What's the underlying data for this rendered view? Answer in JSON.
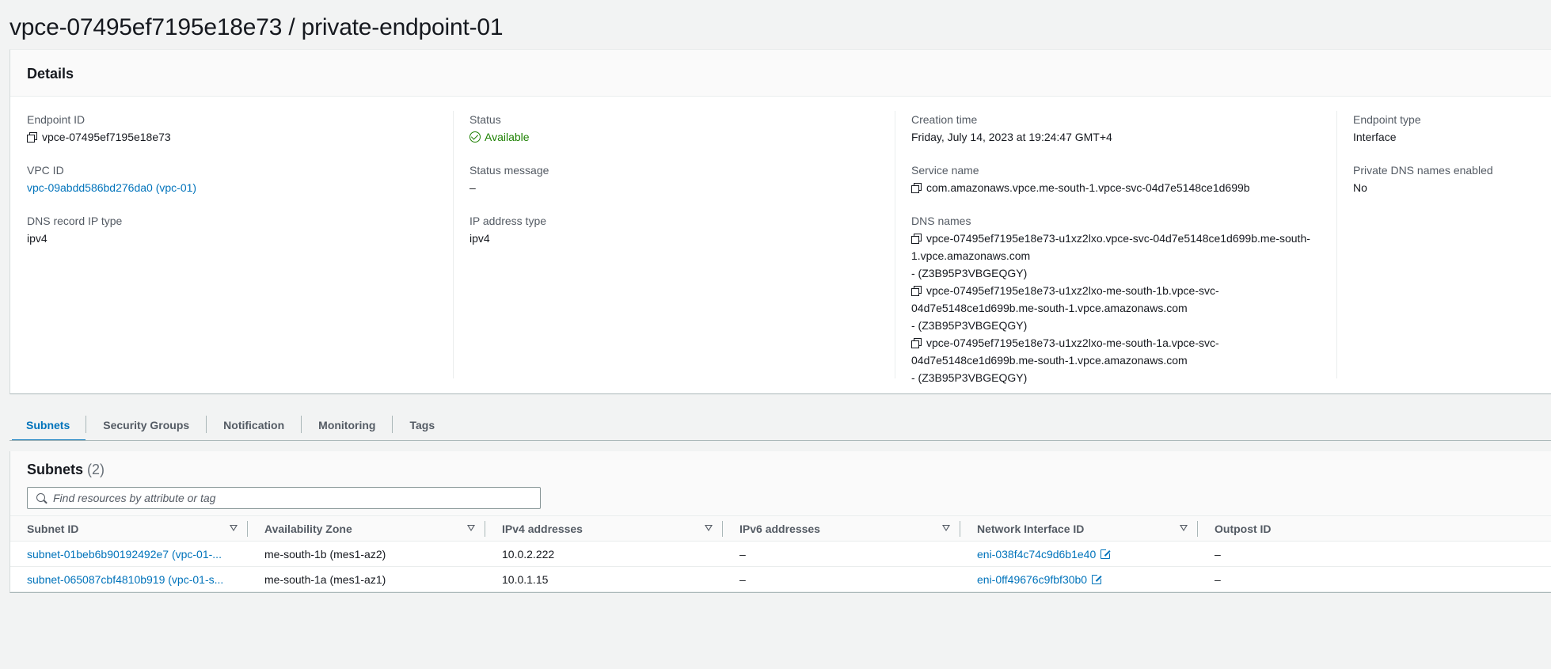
{
  "page": {
    "title": "vpce-07495ef7195e18e73 / private-endpoint-01"
  },
  "details": {
    "heading": "Details",
    "endpoint_id": {
      "label": "Endpoint ID",
      "value": "vpce-07495ef7195e18e73"
    },
    "vpc_id": {
      "label": "VPC ID",
      "value": "vpc-09abdd586bd276da0 (vpc-01)"
    },
    "dns_record_ip_type": {
      "label": "DNS record IP type",
      "value": "ipv4"
    },
    "status": {
      "label": "Status",
      "value": "Available"
    },
    "status_message": {
      "label": "Status message",
      "value": "–"
    },
    "ip_address_type": {
      "label": "IP address type",
      "value": "ipv4"
    },
    "creation_time": {
      "label": "Creation time",
      "value": "Friday, July 14, 2023 at 19:24:47 GMT+4"
    },
    "service_name": {
      "label": "Service name",
      "value": "com.amazonaws.vpce.me-south-1.vpce-svc-04d7e5148ce1d699b"
    },
    "dns_names": {
      "label": "DNS names",
      "entries": [
        {
          "line1": "vpce-07495ef7195e18e73-u1xz2lxo.vpce-svc-04d7e5148ce1d699b.me-south-",
          "line2": "1.vpce.amazonaws.com",
          "zone": "- (Z3B95P3VBGEQGY)"
        },
        {
          "line1": "vpce-07495ef7195e18e73-u1xz2lxo-me-south-1b.vpce-svc-",
          "line2": "04d7e5148ce1d699b.me-south-1.vpce.amazonaws.com",
          "zone": "- (Z3B95P3VBGEQGY)"
        },
        {
          "line1": "vpce-07495ef7195e18e73-u1xz2lxo-me-south-1a.vpce-svc-",
          "line2": "04d7e5148ce1d699b.me-south-1.vpce.amazonaws.com",
          "zone": "- (Z3B95P3VBGEQGY)"
        }
      ]
    },
    "endpoint_type": {
      "label": "Endpoint type",
      "value": "Interface"
    },
    "private_dns": {
      "label": "Private DNS names enabled",
      "value": "No"
    }
  },
  "tabs": [
    "Subnets",
    "Security Groups",
    "Notification",
    "Monitoring",
    "Tags"
  ],
  "subnets": {
    "heading": "Subnets",
    "count": "(2)",
    "search_placeholder": "Find resources by attribute or tag",
    "columns": [
      "Subnet ID",
      "Availability Zone",
      "IPv4 addresses",
      "IPv6 addresses",
      "Network Interface ID",
      "Outpost ID"
    ],
    "rows": [
      {
        "subnet_id": "subnet-01beb6b90192492e7 (vpc-01-...",
        "az": "me-south-1b (mes1-az2)",
        "ipv4": "10.0.2.222",
        "ipv6": "–",
        "eni": "eni-038f4c74c9d6b1e40",
        "outpost": "–"
      },
      {
        "subnet_id": "subnet-065087cbf4810b919 (vpc-01-s...",
        "az": "me-south-1a (mes1-az1)",
        "ipv4": "10.0.1.15",
        "ipv6": "–",
        "eni": "eni-0ff49676c9fbf30b0",
        "outpost": "–"
      }
    ]
  },
  "colors": {
    "link": "#0073bb",
    "success": "#1d8102",
    "background": "#f2f3f3"
  },
  "icons": [
    "copy-icon",
    "check-circle-icon",
    "search-icon",
    "sort-icon",
    "external-link-icon"
  ]
}
